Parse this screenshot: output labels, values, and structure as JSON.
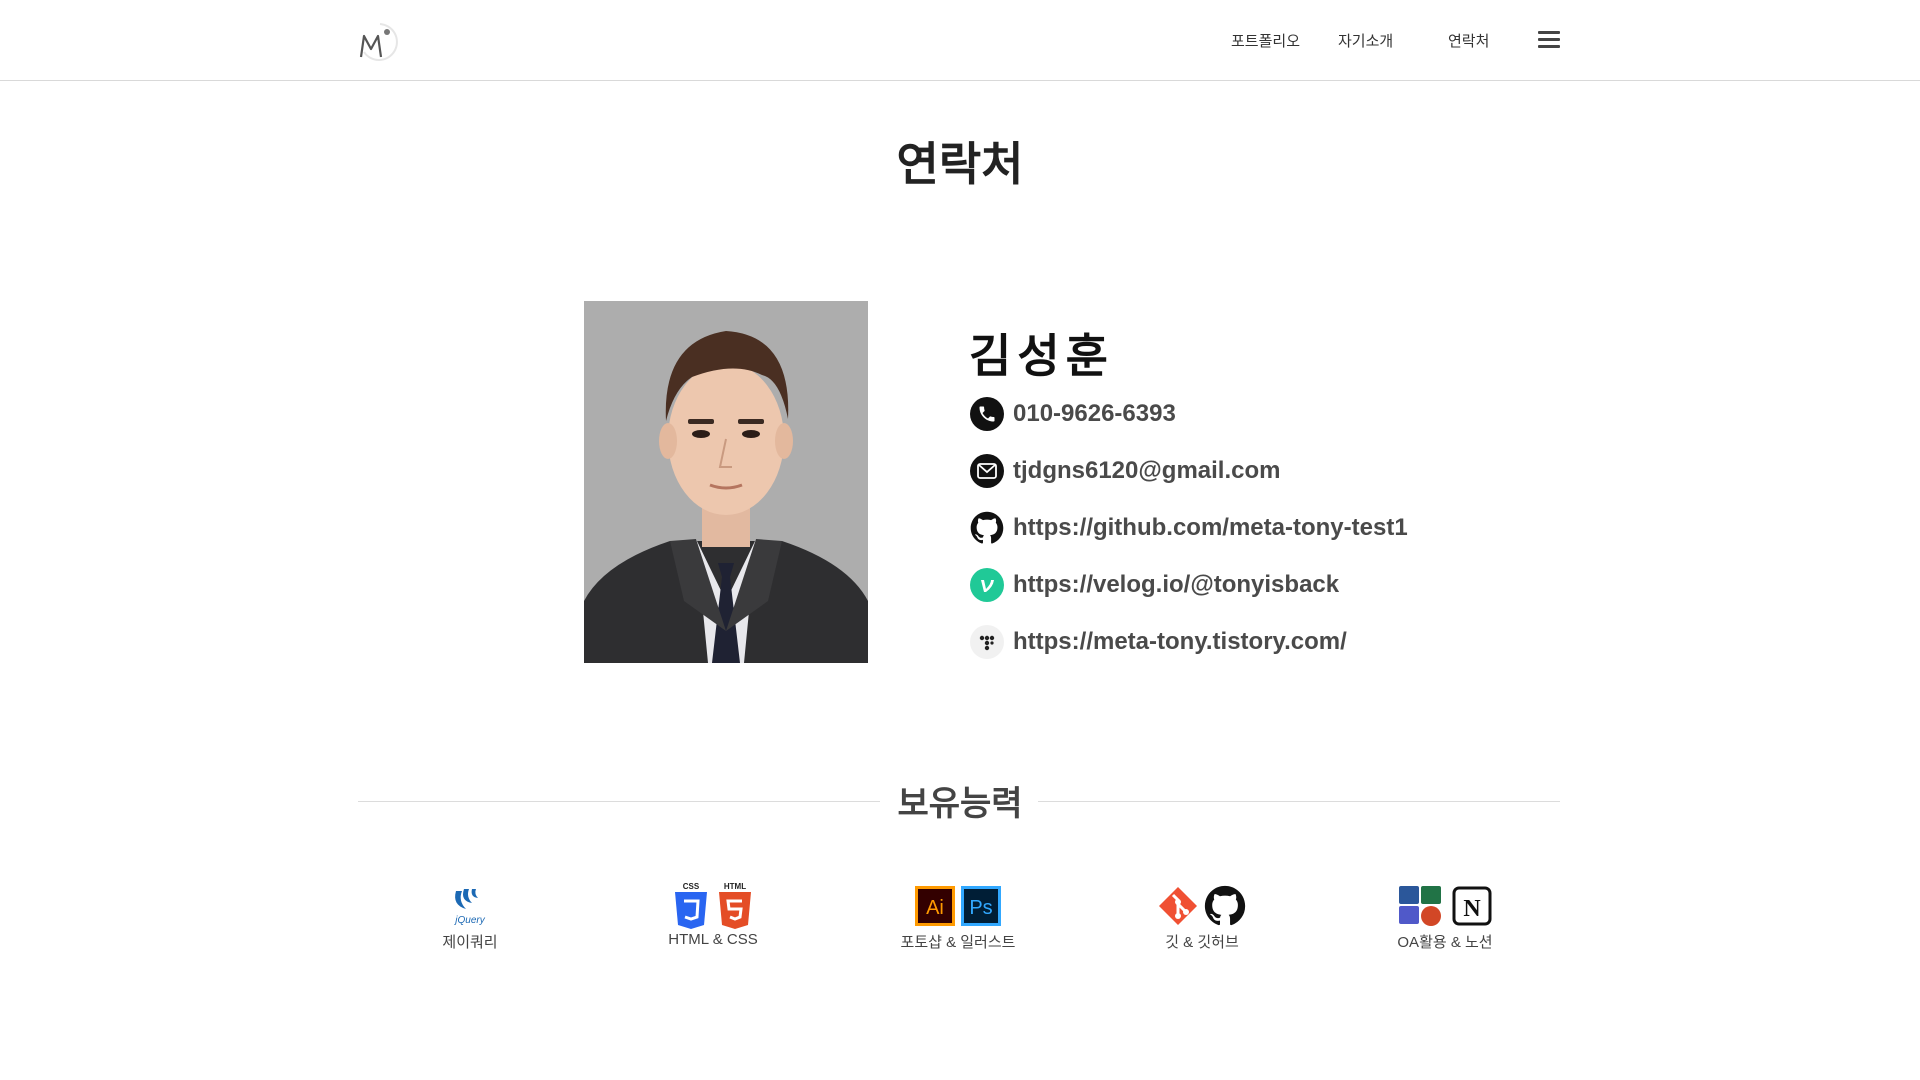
{
  "header": {
    "logo_icon": "m-logo-icon",
    "nav": [
      {
        "label": "포트폴리오"
      },
      {
        "label": "자기소개"
      },
      {
        "label": "연락처"
      }
    ],
    "menu_icon": "hamburger-menu-icon"
  },
  "page": {
    "title": "연락처"
  },
  "profile": {
    "name": "김성훈",
    "photo": "profile-photo",
    "contacts": [
      {
        "icon": "phone-icon",
        "text": "010-9626-6393"
      },
      {
        "icon": "mail-icon",
        "text": "tjdgns6120@gmail.com"
      },
      {
        "icon": "github-icon",
        "text": "https://github.com/meta-tony-test1"
      },
      {
        "icon": "velog-icon",
        "text": "https://velog.io/@tonyisback"
      },
      {
        "icon": "tistory-icon",
        "text": "https://meta-tony.tistory.com/"
      }
    ]
  },
  "skills": {
    "heading": "보유능력",
    "items": [
      {
        "label": "제이쿼리",
        "icons": [
          "jquery-icon"
        ],
        "jquery_logo_text": "jQuery"
      },
      {
        "label": "HTML & CSS",
        "icons": [
          "css3-icon",
          "html5-icon"
        ],
        "css_text": "CSS",
        "html_text": "HTML"
      },
      {
        "label": "포토샵 & 일러스트",
        "icons": [
          "illustrator-icon",
          "photoshop-icon"
        ],
        "ai_text": "Ai",
        "ps_text": "Ps"
      },
      {
        "label": "깃 & 깃허브",
        "icons": [
          "git-icon",
          "github-icon"
        ]
      },
      {
        "label": "OA활용 & 노션",
        "icons": [
          "office-icon",
          "notion-icon"
        ],
        "notion_text": "N"
      }
    ]
  },
  "colors": {
    "text_dark": "#222222",
    "text_contact": "#4a4a4a",
    "velog_green": "#20c997",
    "git_orange": "#f05033",
    "css_blue": "#2965f1",
    "html_orange": "#e44d26",
    "ai_orange": "#ff9a00",
    "ps_blue": "#31a8ff"
  }
}
